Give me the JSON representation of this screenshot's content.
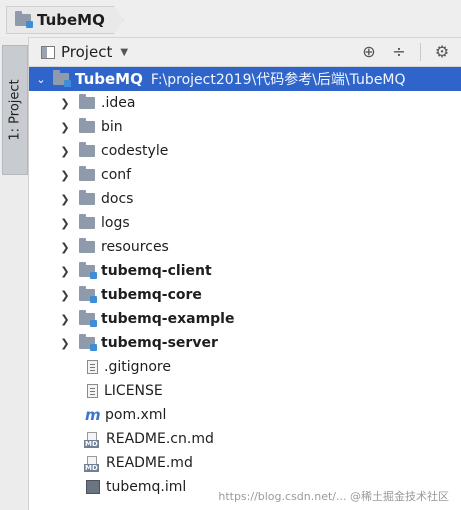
{
  "breadcrumb": {
    "label": "TubeMQ"
  },
  "toolwindow": {
    "tab_label": "1: Project"
  },
  "panel": {
    "view_label": "Project",
    "tools": [
      "crosshair-icon",
      "collapse-icon",
      "gear-icon"
    ]
  },
  "tree": {
    "root": {
      "name": "TubeMQ",
      "path": "F:\\project2019\\代码参考\\后端\\TubeMQ"
    },
    "items": [
      {
        "name": ".idea",
        "type": "folder"
      },
      {
        "name": "bin",
        "type": "folder"
      },
      {
        "name": "codestyle",
        "type": "folder"
      },
      {
        "name": "conf",
        "type": "folder"
      },
      {
        "name": "docs",
        "type": "folder"
      },
      {
        "name": "logs",
        "type": "folder"
      },
      {
        "name": "resources",
        "type": "folder"
      },
      {
        "name": "tubemq-client",
        "type": "module"
      },
      {
        "name": "tubemq-core",
        "type": "module"
      },
      {
        "name": "tubemq-example",
        "type": "module"
      },
      {
        "name": "tubemq-server",
        "type": "module"
      },
      {
        "name": ".gitignore",
        "type": "text-file"
      },
      {
        "name": "LICENSE",
        "type": "text-file"
      },
      {
        "name": "pom.xml",
        "type": "maven-file"
      },
      {
        "name": "README.cn.md",
        "type": "markdown-file"
      },
      {
        "name": "README.md",
        "type": "markdown-file"
      },
      {
        "name": "tubemq.iml",
        "type": "iml-file"
      }
    ]
  },
  "watermark": "https://blog.csdn.net/... @稀土掘金技术社区"
}
